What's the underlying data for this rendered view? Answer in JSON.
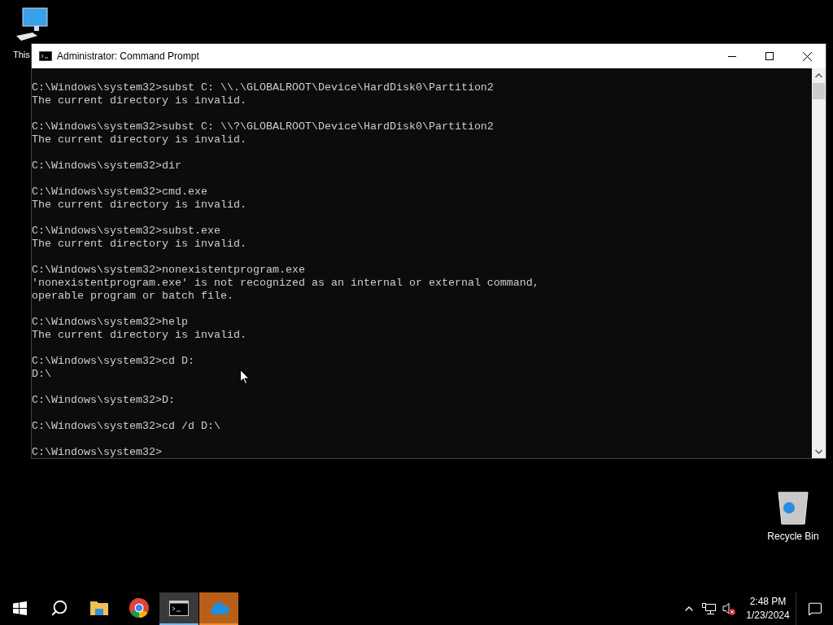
{
  "desktop": {
    "icons": [
      {
        "kind": "computer",
        "label": "This"
      },
      {
        "kind": "recycle",
        "label": "Recycle Bin"
      }
    ]
  },
  "window": {
    "title": "Administrator: Command Prompt",
    "console": {
      "blocks": [
        [
          "C:\\Windows\\system32>subst C: \\\\.\\GLOBALROOT\\Device\\HardDisk0\\Partition2",
          "The current directory is invalid."
        ],
        [
          "C:\\Windows\\system32>subst C: \\\\?\\GLOBALROOT\\Device\\HardDisk0\\Partition2",
          "The current directory is invalid."
        ],
        [
          "C:\\Windows\\system32>dir"
        ],
        [
          "C:\\Windows\\system32>cmd.exe",
          "The current directory is invalid."
        ],
        [
          "C:\\Windows\\system32>subst.exe",
          "The current directory is invalid."
        ],
        [
          "C:\\Windows\\system32>nonexistentprogram.exe",
          "'nonexistentprogram.exe' is not recognized as an internal or external command,",
          "operable program or batch file."
        ],
        [
          "C:\\Windows\\system32>help",
          "The current directory is invalid."
        ],
        [
          "C:\\Windows\\system32>cd D:",
          "D:\\"
        ],
        [
          "C:\\Windows\\system32>D:"
        ],
        [
          "C:\\Windows\\system32>cd /d D:\\"
        ],
        [
          "C:\\Windows\\system32>"
        ]
      ]
    }
  },
  "taskbar": {
    "items": [
      {
        "kind": "start",
        "selected": false,
        "attention": false
      },
      {
        "kind": "search",
        "selected": false,
        "attention": false
      },
      {
        "kind": "explorer",
        "selected": false,
        "attention": false
      },
      {
        "kind": "chrome",
        "selected": false,
        "attention": false
      },
      {
        "kind": "cmd",
        "selected": true,
        "attention": false
      },
      {
        "kind": "onedrive",
        "selected": false,
        "attention": true
      }
    ],
    "clock": {
      "time": "2:48 PM",
      "date": "1/23/2024"
    }
  }
}
